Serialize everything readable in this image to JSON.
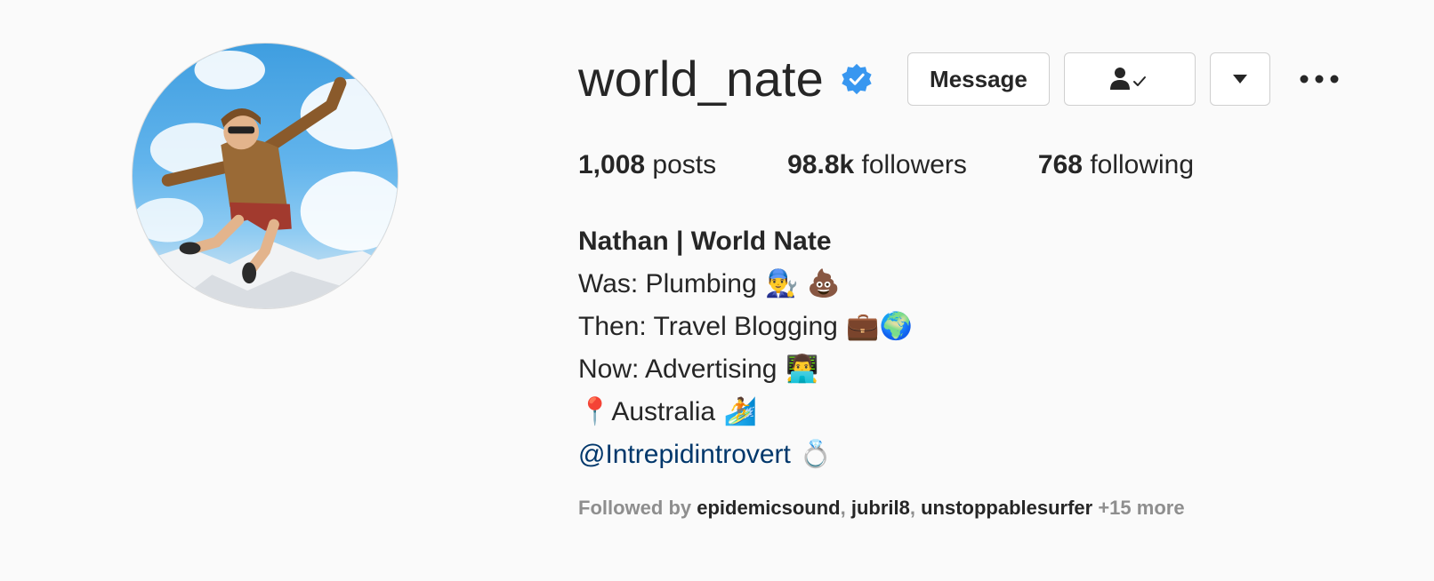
{
  "profile": {
    "username": "world_nate",
    "verified": true,
    "accent_color": "#3897f0",
    "buttons": {
      "message": "Message",
      "following_icon": "person-check-icon",
      "dropdown_icon": "caret-down-icon",
      "more_icon": "ellipsis-icon"
    }
  },
  "stats": {
    "posts_count": "1,008",
    "posts_label": " posts",
    "followers_count": "98.8k",
    "followers_label": " followers",
    "following_count": "768",
    "following_label": " following"
  },
  "bio": {
    "full_name": "Nathan | World Nate",
    "line1": "Was: Plumbing",
    "line1_emoji": " 👨‍🔧 💩",
    "line2": "Then: Travel Blogging",
    "line2_emoji": " 💼🌍",
    "line3": "Now: Advertising",
    "line3_emoji": " 👨‍💻",
    "line4_pin": "📍",
    "line4": "Australia",
    "line4_emoji": " 🏄",
    "mention": "@Intrepidintrovert",
    "mention_emoji": " 💍",
    "mention_color": "#00376b"
  },
  "followed_by": {
    "prefix": "Followed by ",
    "users": [
      "epidemicsound",
      "jubril8",
      "unstoppablesurfer"
    ],
    "sep": ", ",
    "more": " +15 more"
  }
}
